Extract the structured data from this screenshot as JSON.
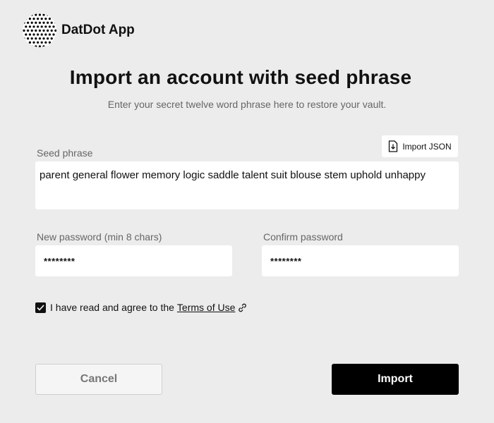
{
  "header": {
    "app_name": "DatDot App",
    "logo_icon": "dotted-circle-logo"
  },
  "main": {
    "title": "Import an account with seed phrase",
    "subtitle": "Enter your secret twelve word phrase here to restore your vault.",
    "import_json_label": "Import JSON",
    "seed_phrase": {
      "label": "Seed phrase",
      "value": "parent general flower memory logic saddle talent suit blouse stem uphold unhappy"
    },
    "new_password": {
      "label": "New password (min 8 chars)",
      "value": "********"
    },
    "confirm_password": {
      "label": "Confirm password",
      "value": "********"
    },
    "agreement": {
      "checked": true,
      "text": "I have read and agree to the",
      "link_text": "Terms of Use"
    },
    "buttons": {
      "cancel": "Cancel",
      "import": "Import"
    }
  },
  "colors": {
    "background": "#ececec",
    "primary": "#000000",
    "muted_text": "#666666"
  }
}
